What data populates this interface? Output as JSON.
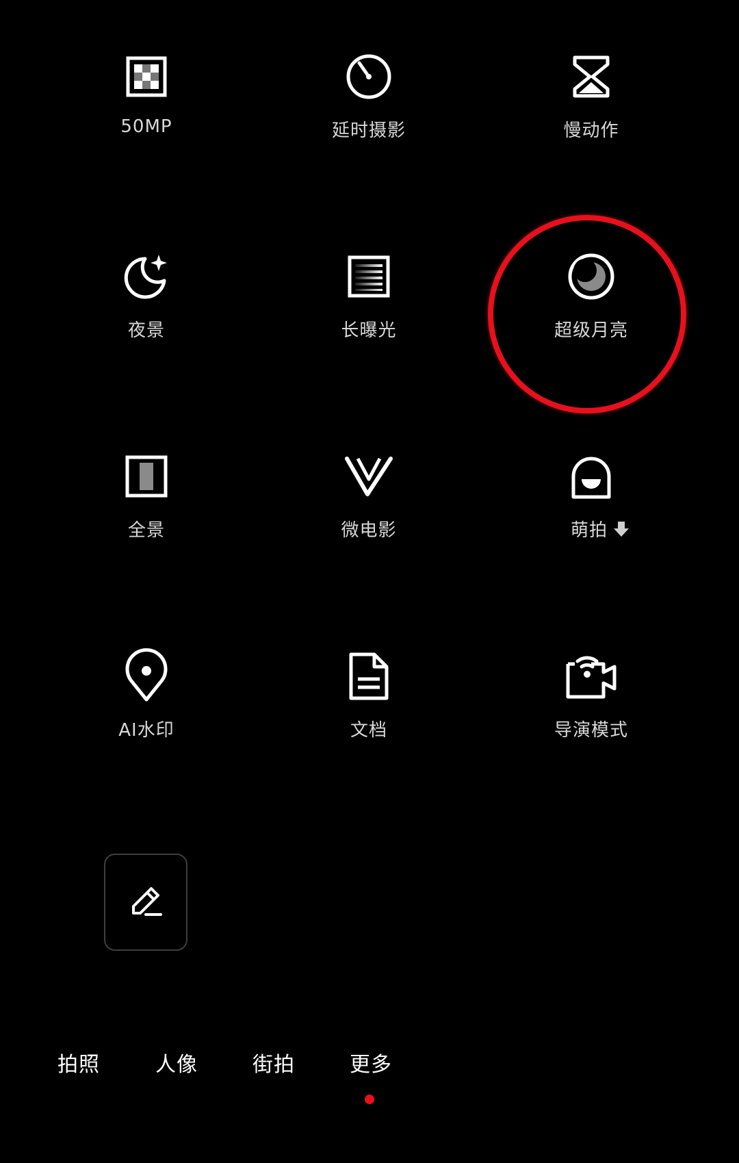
{
  "modes": [
    {
      "id": "50mp",
      "label": "50MP",
      "icon": "grid-pixel-icon"
    },
    {
      "id": "timelapse",
      "label": "延时摄影",
      "icon": "timer-icon"
    },
    {
      "id": "slowmo",
      "label": "慢动作",
      "icon": "hourglass-icon"
    },
    {
      "id": "night",
      "label": "夜景",
      "icon": "moon-star-icon"
    },
    {
      "id": "long-exposure",
      "label": "长曝光",
      "icon": "long-exposure-icon"
    },
    {
      "id": "super-moon",
      "label": "超级月亮",
      "icon": "super-moon-icon"
    },
    {
      "id": "panorama",
      "label": "全景",
      "icon": "panorama-icon"
    },
    {
      "id": "vlog",
      "label": "微电影",
      "icon": "v-icon"
    },
    {
      "id": "cute",
      "label": "萌拍",
      "icon": "cute-face-icon",
      "download_icon": "download-arrow-icon"
    },
    {
      "id": "ai-watermark",
      "label": "AI水印",
      "icon": "location-pin-icon"
    },
    {
      "id": "document",
      "label": "文档",
      "icon": "document-icon"
    },
    {
      "id": "director",
      "label": "导演模式",
      "icon": "director-camera-icon"
    }
  ],
  "edit_button_icon": "pencil-icon",
  "tabs": [
    {
      "label": "拍照"
    },
    {
      "label": "人像"
    },
    {
      "label": "街拍"
    },
    {
      "label": "更多",
      "active": true
    }
  ],
  "colors": {
    "background": "#000000",
    "icon": "#ffffff",
    "highlight_ring": "#e8101d",
    "active_dot": "#e8101d"
  }
}
